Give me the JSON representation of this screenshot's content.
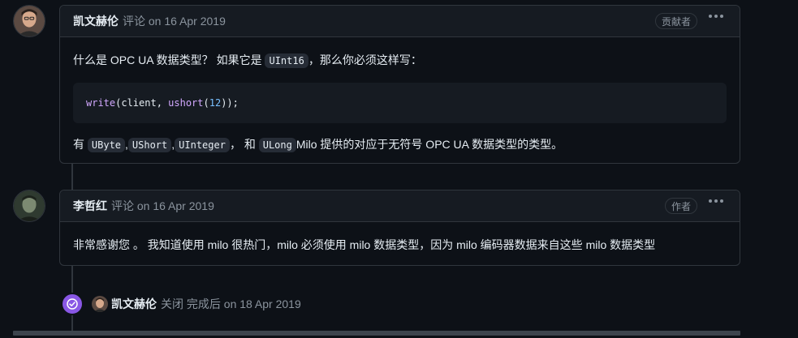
{
  "comments": [
    {
      "author": "凯文赫伦",
      "meta": "评论 on 16 Apr 2019",
      "role": "贡献者",
      "body": {
        "line1_before": "什么是 OPC UA 数据类型？ 如果它是 ",
        "line1_code": "UInt16",
        "line1_after": "，那么你必须这样写：",
        "code_fn": "write",
        "code_args": "(client, ",
        "code_fn2": "ushort",
        "code_paren_open": "(",
        "code_num": "12",
        "code_end": "));",
        "line2_prefix": "有 ",
        "types": [
          "UByte",
          "UShort",
          "UInteger",
          "ULong"
        ],
        "sep": ",",
        "and_text": "， 和 ",
        "line2_suffix": "Milo 提供的对应于无符号 OPC UA 数据类型的类型。"
      }
    },
    {
      "author": "李哲红",
      "meta": "评论 on 16 Apr 2019",
      "role": "作者",
      "body": {
        "text": "非常感谢您 。 我知道使用 milo 很热门，milo 必须使用 milo 数据类型，因为 milo 编码器数据来自这些 milo 数据类型"
      }
    }
  ],
  "event": {
    "author": "凯文赫伦",
    "text": "关闭 完成后 on 18 Apr 2019"
  },
  "icons": {
    "more": "kebab-horizontal-icon",
    "closed": "check-circle-icon"
  },
  "colors": {
    "background": "#0d1117",
    "header_bg": "#161b22",
    "border": "#30363d",
    "muted": "#8b949e",
    "event_purple": "#8957e5"
  }
}
